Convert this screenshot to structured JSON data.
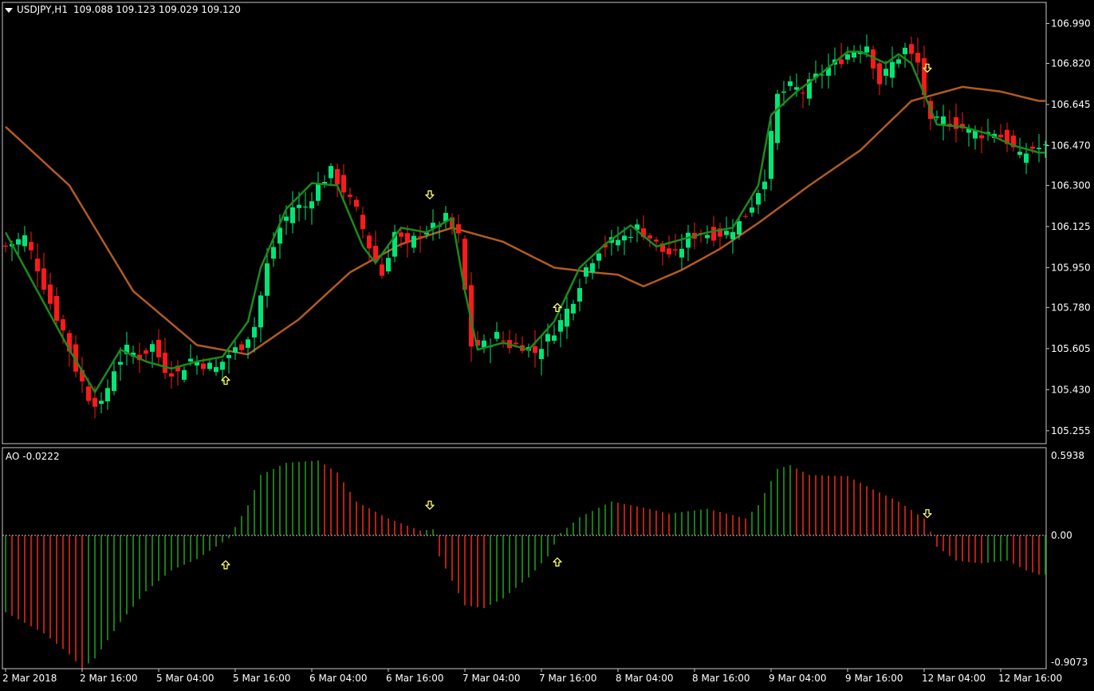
{
  "chart_data": [
    {
      "type": "candlestick",
      "title": "USDJPY,H1",
      "ohlc_readout": "109.088 109.123 109.029 109.120",
      "y_tick_labels": [
        "106.990",
        "106.820",
        "106.645",
        "106.470",
        "106.300",
        "106.125",
        "105.950",
        "105.780",
        "105.605",
        "105.430",
        "105.255"
      ],
      "y_ticks": [
        106.99,
        106.82,
        106.645,
        106.47,
        106.3,
        106.125,
        105.95,
        105.78,
        105.605,
        105.43,
        105.255
      ],
      "ylim": [
        105.2,
        107.08
      ],
      "x_tick_labels": [
        "2 Mar 2018",
        "2 Mar 16:00",
        "5 Mar 04:00",
        "5 Mar 16:00",
        "6 Mar 04:00",
        "6 Mar 16:00",
        "7 Mar 04:00",
        "7 Mar 16:00",
        "8 Mar 04:00",
        "8 Mar 16:00",
        "9 Mar 04:00",
        "9 Mar 16:00",
        "12 Mar 04:00",
        "12 Mar 16:00"
      ],
      "bars_per_x_tick": 12,
      "grid": false,
      "colors": {
        "bull": "#00e676",
        "bear": "#ff1a1a",
        "fast_ma": "#1a8c1a",
        "slow_ma": "#b35b22",
        "signal": "#ffff66"
      },
      "anchor_closes": [
        [
          0,
          106.04
        ],
        [
          3,
          106.08
        ],
        [
          5,
          105.95
        ],
        [
          7,
          105.8
        ],
        [
          9,
          105.68
        ],
        [
          11,
          105.52
        ],
        [
          13,
          105.4
        ],
        [
          15,
          105.36
        ],
        [
          17,
          105.52
        ],
        [
          19,
          105.6
        ],
        [
          21,
          105.57
        ],
        [
          23,
          105.62
        ],
        [
          25,
          105.52
        ],
        [
          27,
          105.5
        ],
        [
          29,
          105.56
        ],
        [
          31,
          105.54
        ],
        [
          33,
          105.52
        ],
        [
          35,
          105.58
        ],
        [
          37,
          105.62
        ],
        [
          39,
          105.7
        ],
        [
          41,
          105.96
        ],
        [
          43,
          106.12
        ],
        [
          45,
          106.21
        ],
        [
          47,
          106.21
        ],
        [
          49,
          106.3
        ],
        [
          51,
          106.36
        ],
        [
          53,
          106.28
        ],
        [
          55,
          106.19
        ],
        [
          57,
          106.04
        ],
        [
          59,
          105.92
        ],
        [
          61,
          106.1
        ],
        [
          63,
          106.04
        ],
        [
          65,
          106.1
        ],
        [
          67,
          106.12
        ],
        [
          69,
          106.16
        ],
        [
          71,
          106.08
        ],
        [
          73,
          105.62
        ],
        [
          75,
          105.62
        ],
        [
          77,
          105.66
        ],
        [
          79,
          105.62
        ],
        [
          81,
          105.62
        ],
        [
          83,
          105.59
        ],
        [
          85,
          105.65
        ],
        [
          87,
          105.72
        ],
        [
          89,
          105.82
        ],
        [
          91,
          105.95
        ],
        [
          93,
          106.03
        ],
        [
          95,
          106.06
        ],
        [
          97,
          106.08
        ],
        [
          99,
          106.12
        ],
        [
          101,
          106.08
        ],
        [
          103,
          106.02
        ],
        [
          105,
          106.0
        ],
        [
          107,
          106.08
        ],
        [
          109,
          106.1
        ],
        [
          111,
          106.09
        ],
        [
          113,
          106.1
        ],
        [
          115,
          106.14
        ],
        [
          117,
          106.22
        ],
        [
          119,
          106.34
        ],
        [
          121,
          106.68
        ],
        [
          123,
          106.72
        ],
        [
          125,
          106.7
        ],
        [
          127,
          106.76
        ],
        [
          129,
          106.8
        ],
        [
          131,
          106.84
        ],
        [
          133,
          106.88
        ],
        [
          135,
          106.9
        ],
        [
          137,
          106.74
        ],
        [
          139,
          106.82
        ],
        [
          141,
          106.88
        ],
        [
          143,
          106.82
        ],
        [
          145,
          106.56
        ],
        [
          147,
          106.58
        ],
        [
          149,
          106.56
        ],
        [
          151,
          106.53
        ],
        [
          153,
          106.52
        ],
        [
          155,
          106.53
        ],
        [
          157,
          106.49
        ],
        [
          159,
          106.42
        ],
        [
          161,
          106.46
        ]
      ],
      "overlays": [
        {
          "role": "fast moving average",
          "anchor_values": [
            [
              0,
              106.1
            ],
            [
              10,
              105.6
            ],
            [
              14,
              105.42
            ],
            [
              18,
              105.6
            ],
            [
              22,
              105.55
            ],
            [
              26,
              105.52
            ],
            [
              30,
              105.55
            ],
            [
              34,
              105.57
            ],
            [
              38,
              105.72
            ],
            [
              40,
              105.95
            ],
            [
              44,
              106.2
            ],
            [
              48,
              106.31
            ],
            [
              52,
              106.3
            ],
            [
              56,
              106.04
            ],
            [
              58,
              105.97
            ],
            [
              62,
              106.12
            ],
            [
              66,
              106.1
            ],
            [
              70,
              106.16
            ],
            [
              72,
              105.85
            ],
            [
              74,
              105.6
            ],
            [
              78,
              105.63
            ],
            [
              82,
              105.6
            ],
            [
              86,
              105.72
            ],
            [
              90,
              105.95
            ],
            [
              94,
              106.05
            ],
            [
              98,
              106.13
            ],
            [
              102,
              106.04
            ],
            [
              106,
              106.07
            ],
            [
              110,
              106.1
            ],
            [
              114,
              106.12
            ],
            [
              118,
              106.3
            ],
            [
              120,
              106.6
            ],
            [
              124,
              106.7
            ],
            [
              128,
              106.78
            ],
            [
              132,
              106.87
            ],
            [
              134,
              106.87
            ],
            [
              138,
              106.82
            ],
            [
              140,
              106.86
            ],
            [
              142,
              106.82
            ],
            [
              146,
              106.56
            ],
            [
              150,
              106.55
            ],
            [
              154,
              106.52
            ],
            [
              158,
              106.47
            ],
            [
              162,
              106.44
            ]
          ]
        },
        {
          "role": "slow moving average",
          "anchor_values": [
            [
              0,
              106.55
            ],
            [
              10,
              106.3
            ],
            [
              20,
              105.85
            ],
            [
              30,
              105.62
            ],
            [
              38,
              105.58
            ],
            [
              46,
              105.73
            ],
            [
              54,
              105.93
            ],
            [
              62,
              106.05
            ],
            [
              70,
              106.12
            ],
            [
              78,
              106.06
            ],
            [
              86,
              105.95
            ],
            [
              92,
              105.93
            ],
            [
              96,
              105.92
            ],
            [
              100,
              105.87
            ],
            [
              106,
              105.94
            ],
            [
              112,
              106.03
            ],
            [
              118,
              106.14
            ],
            [
              126,
              106.3
            ],
            [
              134,
              106.45
            ],
            [
              142,
              106.66
            ],
            [
              150,
              106.72
            ],
            [
              156,
              106.7
            ],
            [
              162,
              106.66
            ]
          ]
        }
      ],
      "signals": [
        {
          "bar": 35,
          "direction": "up",
          "price": 105.47
        },
        {
          "bar": 67,
          "direction": "down",
          "price": 106.26
        },
        {
          "bar": 87,
          "direction": "up",
          "price": 105.78
        },
        {
          "bar": 145,
          "direction": "down",
          "price": 106.8
        }
      ]
    },
    {
      "type": "histogram",
      "title": "AO -0.0222",
      "y_tick_labels": [
        "0.5938",
        "0.00",
        "-0.9073"
      ],
      "y_ticks": [
        0.5938,
        0.0,
        -0.9073
      ],
      "ylim": [
        -0.9073,
        0.5938
      ],
      "zero_line": true,
      "colors": {
        "up": "#1f9a1f",
        "down": "#e8251a",
        "zero_line": "#c8c8c8"
      },
      "anchor_values": [
        [
          0,
          -0.55
        ],
        [
          6,
          -0.7
        ],
        [
          10,
          -0.85
        ],
        [
          12,
          -0.95
        ],
        [
          14,
          -0.88
        ],
        [
          18,
          -0.62
        ],
        [
          22,
          -0.4
        ],
        [
          26,
          -0.25
        ],
        [
          30,
          -0.17
        ],
        [
          33,
          -0.08
        ],
        [
          35,
          -0.02
        ],
        [
          36,
          0.07
        ],
        [
          38,
          0.25
        ],
        [
          40,
          0.5
        ],
        [
          44,
          0.6
        ],
        [
          49,
          0.62
        ],
        [
          52,
          0.52
        ],
        [
          55,
          0.28
        ],
        [
          60,
          0.14
        ],
        [
          65,
          0.04
        ],
        [
          67,
          0.05
        ],
        [
          68,
          -0.15
        ],
        [
          72,
          -0.5
        ],
        [
          75,
          -0.52
        ],
        [
          78,
          -0.45
        ],
        [
          82,
          -0.3
        ],
        [
          85,
          -0.15
        ],
        [
          87,
          0.02
        ],
        [
          90,
          0.15
        ],
        [
          95,
          0.28
        ],
        [
          100,
          0.23
        ],
        [
          104,
          0.18
        ],
        [
          110,
          0.22
        ],
        [
          116,
          0.14
        ],
        [
          118,
          0.25
        ],
        [
          121,
          0.55
        ],
        [
          123,
          0.58
        ],
        [
          126,
          0.5
        ],
        [
          132,
          0.49
        ],
        [
          136,
          0.38
        ],
        [
          140,
          0.28
        ],
        [
          144,
          0.14
        ],
        [
          146,
          -0.08
        ],
        [
          149,
          -0.18
        ],
        [
          153,
          -0.2
        ],
        [
          157,
          -0.18
        ],
        [
          160,
          -0.25
        ],
        [
          162,
          -0.28
        ]
      ],
      "signals": [
        {
          "bar": 35,
          "direction": "up",
          "value": -0.21
        },
        {
          "bar": 67,
          "direction": "down",
          "value": 0.25
        },
        {
          "bar": 87,
          "direction": "up",
          "value": -0.19
        },
        {
          "bar": 145,
          "direction": "down",
          "value": 0.18
        }
      ]
    }
  ]
}
